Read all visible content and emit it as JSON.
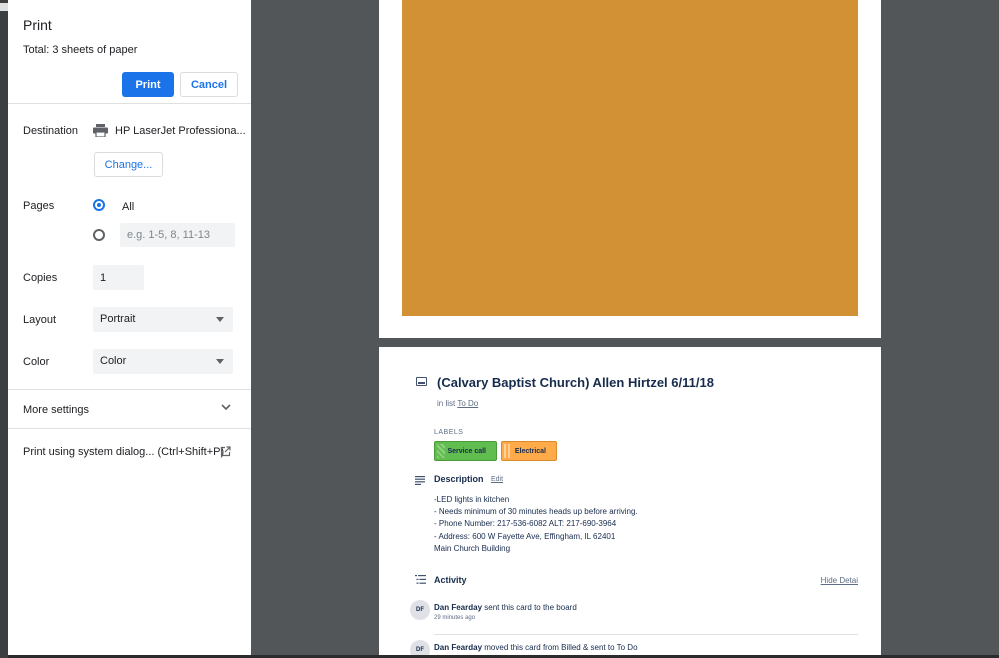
{
  "print_panel": {
    "title": "Print",
    "total": "Total: 3 sheets of paper",
    "print_button": "Print",
    "cancel_button": "Cancel",
    "destination": {
      "label": "Destination",
      "icon": "printer-icon",
      "value": "HP LaserJet Professiona...",
      "change_button": "Change..."
    },
    "pages": {
      "label": "Pages",
      "all_option": "All",
      "custom_placeholder": "e.g. 1-5, 8, 11-13"
    },
    "copies": {
      "label": "Copies",
      "value": "1"
    },
    "layout": {
      "label": "Layout",
      "value": "Portrait"
    },
    "color": {
      "label": "Color",
      "value": "Color"
    },
    "more_settings": "More settings",
    "system_dialog": "Print using system dialog... (Ctrl+Shift+P)"
  },
  "preview": {
    "page1": {
      "image_color": "#d39135"
    },
    "page2": {
      "card_title": "(Calvary Baptist Church) Allen Hirtzel 6/11/18",
      "in_list_prefix": "in list",
      "in_list_link": "To Do",
      "labels_heading": "LABELS",
      "labels": [
        {
          "text": "Service call",
          "color": "#61bd4f"
        },
        {
          "text": "Electrical",
          "color": "#ffab4a"
        }
      ],
      "description_heading": "Description",
      "description_edit": "Edit",
      "description_lines": [
        "-LED lights in kitchen",
        "- Needs minimum of 30 minutes heads up before arriving.",
        "- Phone Number: 217-536-6082 ALT: 217-690-3964",
        "- Address: 600 W Fayette Ave, Effingham, IL 62401",
        "Main Church Building"
      ],
      "activity_heading": "Activity",
      "hide_details": "Hide Detai",
      "activities": [
        {
          "avatar": "DF",
          "user": "Dan Fearday",
          "action": "sent this card to the board",
          "time": "29 minutes ago"
        },
        {
          "avatar": "DF",
          "user": "Dan Fearday",
          "action": "moved this card from Billed & sent to To Do",
          "time": ""
        }
      ]
    }
  }
}
